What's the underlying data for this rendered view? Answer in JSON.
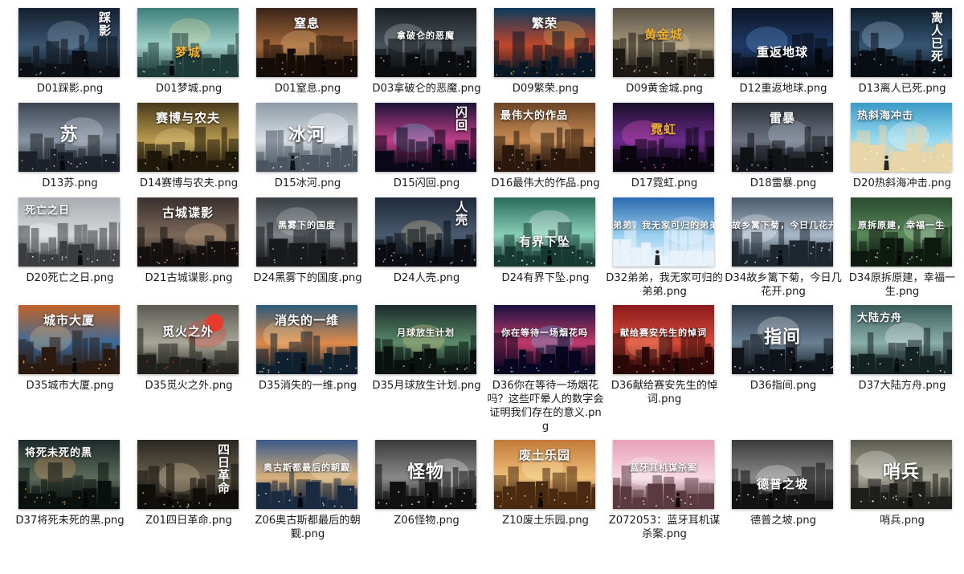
{
  "files": [
    [
      {
        "name": "D01踩影.png",
        "title": "踩影",
        "palette": [
          "#142030",
          "#3a5570",
          "#0c1016"
        ],
        "light": "#9fb6cc",
        "style": "vert"
      },
      {
        "name": "D01梦城.png",
        "title": "梦城",
        "palette": [
          "#3f7f7a",
          "#9fd0c8",
          "#1e3b3a"
        ],
        "light": "#e8e09a",
        "style": "warm-low"
      },
      {
        "name": "D01窒息.png",
        "title": "窒息",
        "palette": [
          "#3a2418",
          "#a3663a",
          "#150c08"
        ],
        "light": "#f0c48a",
        "style": "top"
      },
      {
        "name": "D03拿破仑的恶魔.png",
        "title": "拿破仑的恶魔",
        "palette": [
          "#1a1f24",
          "#4a525a",
          "#0a0c0e"
        ],
        "light": "#c9d0d6",
        "style": "small"
      },
      {
        "name": "D09繁荣.png",
        "title": "繁荣",
        "palette": [
          "#0c3b5c",
          "#c2452a",
          "#081826"
        ],
        "light": "#f5c04a",
        "style": "top"
      },
      {
        "name": "D09黄金城.png",
        "title": "黄金城",
        "palette": [
          "#5a5246",
          "#a89a7e",
          "#1c1914"
        ],
        "light": "#e7d6a8",
        "style": "warm"
      },
      {
        "name": "D12重返地球.png",
        "title": "重返地球",
        "palette": [
          "#0a1526",
          "#1f3a66",
          "#05080f"
        ],
        "light": "#6fa5e8",
        "style": "low"
      },
      {
        "name": "D13离人已死.png",
        "title": "离人已死",
        "palette": [
          "#0f1e2e",
          "#355673",
          "#080d14"
        ],
        "light": "#b8d2ea",
        "style": "vert"
      }
    ],
    [
      {
        "name": "D13苏.png",
        "title": "苏",
        "palette": [
          "#3d4552",
          "#8a95a3",
          "#1c2028"
        ],
        "light": "#dfe5ec",
        "style": "big"
      },
      {
        "name": "D14赛博与农夫.png",
        "title": "赛博与农夫",
        "palette": [
          "#4a3a1c",
          "#b99a4f",
          "#1e170a"
        ],
        "light": "#f4de9a",
        "style": "top"
      },
      {
        "name": "D15冰河.png",
        "title": "冰河",
        "palette": [
          "#8e9aa6",
          "#d9e0e6",
          "#4a5560"
        ],
        "light": "#ffffff",
        "style": "big"
      },
      {
        "name": "D15闪回.png",
        "title": "闪回",
        "palette": [
          "#1c1436",
          "#c23f8a",
          "#0a0818"
        ],
        "light": "#5fd6f0",
        "style": "vert"
      },
      {
        "name": "D16最伟大的作品.png",
        "title": "最伟大的作品",
        "palette": [
          "#6a4426",
          "#c98c54",
          "#2a180c"
        ],
        "light": "#f2c48e",
        "style": "left"
      },
      {
        "name": "D17霓虹.png",
        "title": "霓虹",
        "palette": [
          "#1a0f2a",
          "#6a2a8a",
          "#08050f"
        ],
        "light": "#ff5ad2",
        "style": "warm"
      },
      {
        "name": "D18雷暴.png",
        "title": "雷暴",
        "palette": [
          "#2a2e36",
          "#6a7280",
          "#101216"
        ],
        "light": "#d8e4f2",
        "style": "top"
      },
      {
        "name": "D20热斜海冲击.png",
        "title": "热斜海冲击",
        "palette": [
          "#3a9ac8",
          "#9adcf0",
          "#e8d6a8"
        ],
        "light": "#ffffff",
        "style": "left"
      }
    ],
    [
      {
        "name": "D20死亡之日.png",
        "title": "死亡之日",
        "palette": [
          "#a8acb0",
          "#d6d8da",
          "#3a3c40"
        ],
        "light": "#ffffff",
        "style": "left"
      },
      {
        "name": "D21古城谍影.png",
        "title": "古城谍影",
        "palette": [
          "#3a3030",
          "#7a6858",
          "#141010"
        ],
        "light": "#e8c098",
        "style": "top"
      },
      {
        "name": "D24黑雾下的国度.png",
        "title": "黑雾下的国度",
        "palette": [
          "#3a3e42",
          "#7c8288",
          "#181a1c"
        ],
        "light": "#d0d4d8",
        "style": "small"
      },
      {
        "name": "D24人壳.png",
        "title": "人壳",
        "palette": [
          "#1e2a38",
          "#4a5c70",
          "#0a0e14"
        ],
        "light": "#f0d090",
        "style": "vert"
      },
      {
        "name": "D24有界下坠.png",
        "title": "有界下坠",
        "palette": [
          "#2a6a5a",
          "#8ad0b8",
          "#163a32"
        ],
        "light": "#ffffff",
        "style": "low"
      },
      {
        "name": "D32弟弟，我无家可归的弟弟.png",
        "title": "弟弟，我无家可归的弟弟",
        "palette": [
          "#2a6ab0",
          "#9ad0f0",
          "#e8f2fa"
        ],
        "light": "#ffffff",
        "style": "small"
      },
      {
        "name": "D34故乡篱下菊，今日几花开.png",
        "title": "故乡篱下菊，今日几花开",
        "palette": [
          "#4a5a6a",
          "#a8b8c8",
          "#1e2630"
        ],
        "light": "#ffffff",
        "style": "small"
      },
      {
        "name": "D34原拆原建，幸福一生.png",
        "title": "原拆原建，幸福一生",
        "palette": [
          "#2a4a30",
          "#5a8a5a",
          "#0e1a10"
        ],
        "light": "#e0f0d8",
        "style": "small"
      }
    ],
    [
      {
        "name": "D35城市大厦.png",
        "title": "城市大厦",
        "palette": [
          "#c2642a",
          "#3a6a9a",
          "#2a1a10"
        ],
        "light": "#ffd08a",
        "style": "top"
      },
      {
        "name": "D35觅火之外.png",
        "title": "觅火之外",
        "palette": [
          "#5a5a52",
          "#a8a698",
          "#20201c"
        ],
        "light": "#e83a2a",
        "style": "sun"
      },
      {
        "name": "D35消失的一维.png",
        "title": "消失的一维",
        "palette": [
          "#2a5a7a",
          "#e08a4a",
          "#0e2030"
        ],
        "light": "#ffe0a8",
        "style": "top"
      },
      {
        "name": "D35月球放生计划.png",
        "title": "月球放生计划",
        "palette": [
          "#1a2a2a",
          "#5a8a6a",
          "#0a1210"
        ],
        "light": "#f0e090",
        "style": "small"
      },
      {
        "name": "D36你在等待一场烟花吗？这些吓晕人的数字会证明我们存在的意义.png",
        "title": "你在等待一场烟花吗",
        "palette": [
          "#1a1040",
          "#c03a6a",
          "#080520"
        ],
        "light": "#5ad0ff",
        "style": "small"
      },
      {
        "name": "D36献给赛安先生的悼词.png",
        "title": "献给赛安先生的悼词",
        "palette": [
          "#8a1a1a",
          "#d84a3a",
          "#2a0808"
        ],
        "light": "#ffb080",
        "style": "small"
      },
      {
        "name": "D36指间.png",
        "title": "指间",
        "palette": [
          "#2a3a4a",
          "#6a8094",
          "#0e141a"
        ],
        "light": "#ffffff",
        "style": "big"
      },
      {
        "name": "D37大陆方舟.png",
        "title": "大陆方舟",
        "palette": [
          "#3a5a5a",
          "#8ab0aa",
          "#142222"
        ],
        "light": "#ffffff",
        "style": "left"
      }
    ],
    [
      {
        "name": "D37将死未死的黑.png",
        "title": "将死未死的黑",
        "palette": [
          "#1e2a2a",
          "#5a6a5a",
          "#0a100e"
        ],
        "light": "#f0a060",
        "style": "left"
      },
      {
        "name": "Z01四日革命.png",
        "title": "四日革命",
        "palette": [
          "#2a2620",
          "#6a6250",
          "#100e0a"
        ],
        "light": "#e8d8b0",
        "style": "vert"
      },
      {
        "name": "Z06奥古斯都最后的朝觐.png",
        "title": "奥古斯都最后的朝觐",
        "palette": [
          "#3a5a8a",
          "#d8b07a",
          "#1a2a40"
        ],
        "light": "#fff0d0",
        "style": "small"
      },
      {
        "name": "Z06怪物.png",
        "title": "怪物",
        "palette": [
          "#3a3a3a",
          "#8a8a8a",
          "#101010"
        ],
        "light": "#ffffff",
        "style": "big"
      },
      {
        "name": "Z10废土乐园.png",
        "title": "废土乐园",
        "palette": [
          "#c27a3a",
          "#f0c078",
          "#4a2a10"
        ],
        "light": "#fff0c0",
        "style": "top"
      },
      {
        "name": "Z072053：蓝牙耳机谋杀案.png",
        "title": "蓝牙耳机谋杀案",
        "palette": [
          "#e8a0b8",
          "#f8d8e4",
          "#5a3a40"
        ],
        "light": "#ffffff",
        "style": "small"
      },
      {
        "name": "德普之坡.png",
        "title": "德普之坡",
        "palette": [
          "#3a3a3a",
          "#8a8a8a",
          "#121212"
        ],
        "light": "#ffffff",
        "style": "low"
      },
      {
        "name": "哨兵.png",
        "title": "哨兵",
        "palette": [
          "#5a5a50",
          "#a8a898",
          "#1e1e1a"
        ],
        "light": "#ffffff",
        "style": "big"
      }
    ]
  ]
}
